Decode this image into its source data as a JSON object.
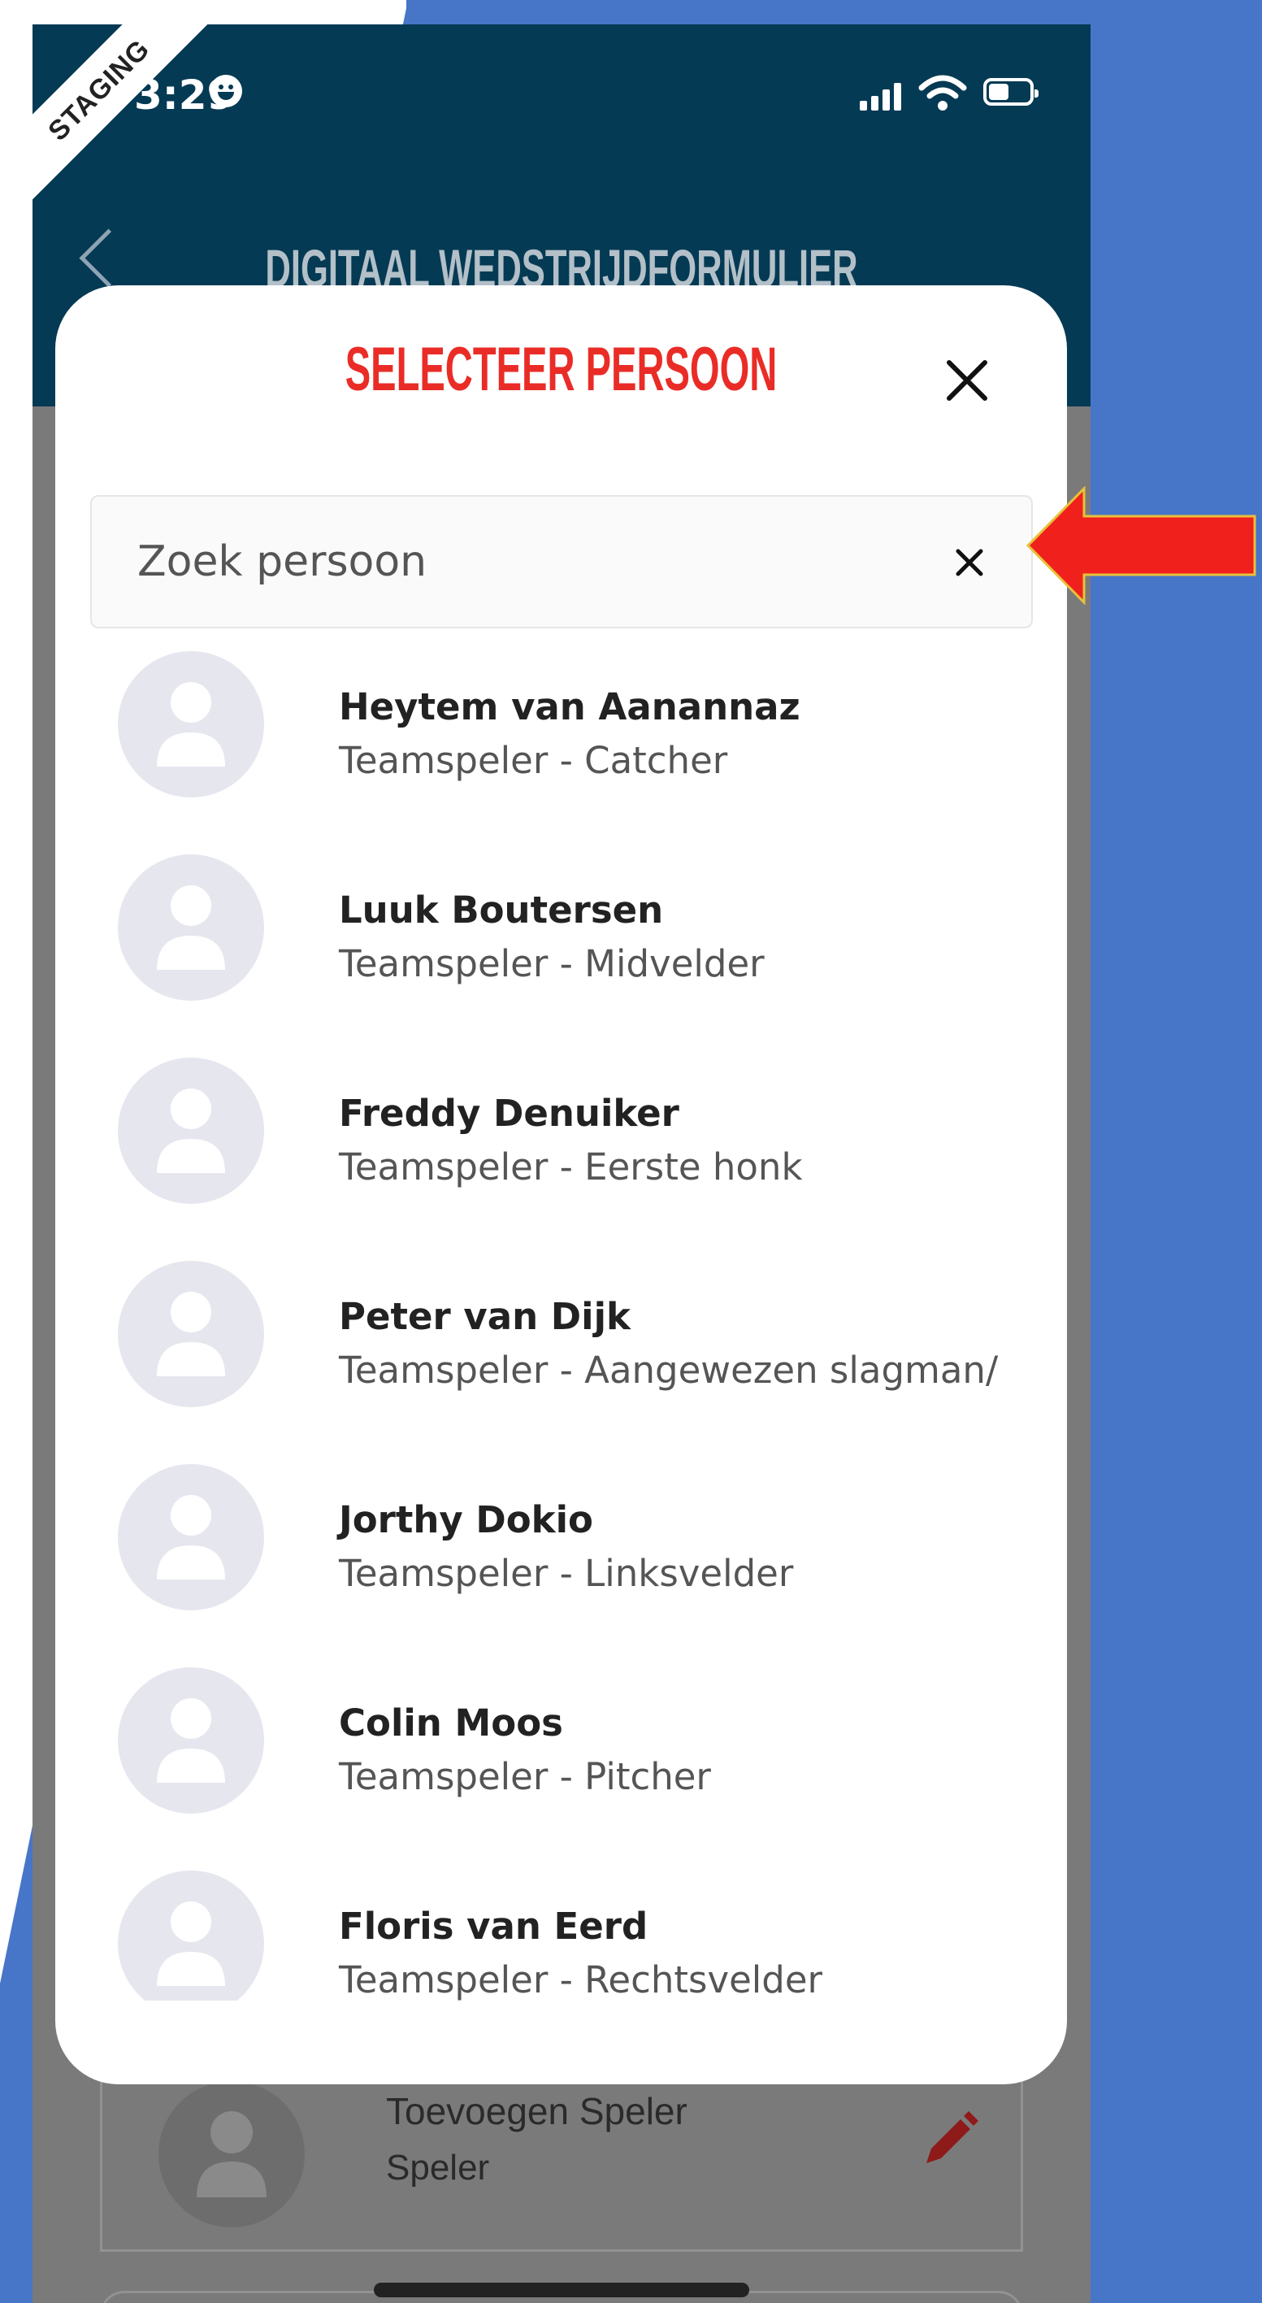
{
  "status_bar": {
    "time": "3:29",
    "staging_label": "STAGING"
  },
  "header": {
    "title": "DIGITAAL WEDSTRIJDFORMULIER",
    "back_icon": "chevron-left-icon"
  },
  "modal": {
    "title": "SELECTEER PERSOON",
    "close_icon": "close-icon",
    "search": {
      "placeholder": "Zoek persoon",
      "value": "",
      "clear_icon": "close-icon"
    },
    "persons": [
      {
        "name": "Heytem van Aanannaz",
        "role": "Teamspeler - Catcher"
      },
      {
        "name": "Luuk Boutersen",
        "role": "Teamspeler - Midvelder"
      },
      {
        "name": "Freddy Denuiker",
        "role": "Teamspeler - Eerste honk"
      },
      {
        "name": "Peter van Dijk",
        "role": "Teamspeler - Aangewezen slagman/"
      },
      {
        "name": "Jorthy Dokio",
        "role": "Teamspeler - Linksvelder"
      },
      {
        "name": "Colin Moos",
        "role": "Teamspeler - Pitcher"
      },
      {
        "name": "Floris van Eerd",
        "role": "Teamspeler - Rechtsvelder"
      }
    ]
  },
  "background_card": {
    "title": "Toevoegen Speler",
    "subtitle": "Speler",
    "edit_icon": "pencil-icon"
  },
  "colors": {
    "page_background": "#4775c8",
    "header": "#053a54",
    "modal_title": "#ea2c27",
    "arrow": "#f0201c",
    "avatar": "#e6e6ef"
  }
}
